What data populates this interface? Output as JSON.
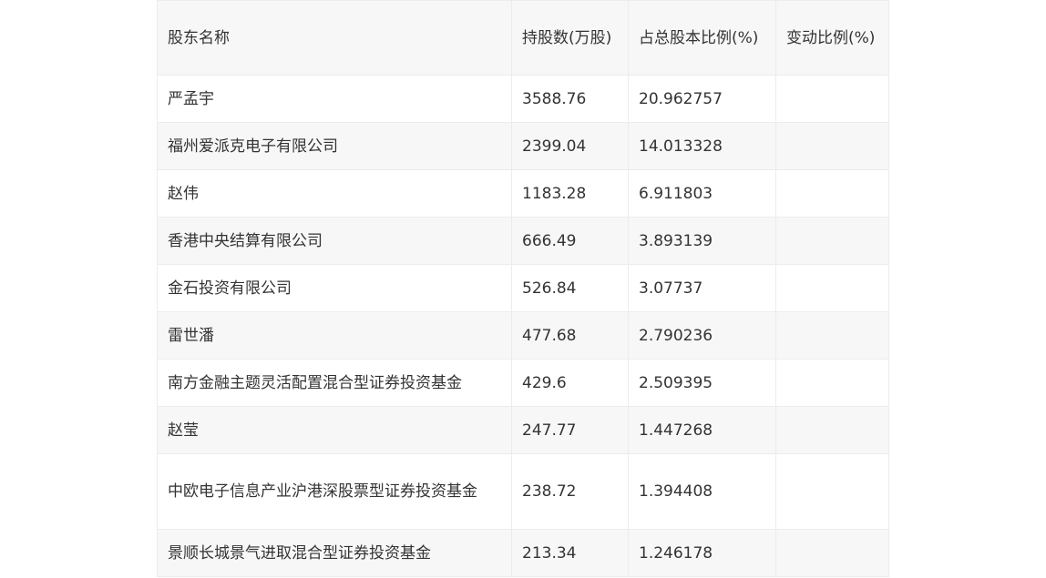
{
  "table": {
    "headers": [
      "股东名称",
      "持股数(万股)",
      "占总股本比例(%)",
      "变动比例(%)"
    ],
    "rows": [
      {
        "name": "严孟宇",
        "shares": "3588.76",
        "ratio": "20.962757",
        "change": ""
      },
      {
        "name": "福州爱派克电子有限公司",
        "shares": "2399.04",
        "ratio": "14.013328",
        "change": ""
      },
      {
        "name": "赵伟",
        "shares": "1183.28",
        "ratio": "6.911803",
        "change": ""
      },
      {
        "name": "香港中央结算有限公司",
        "shares": "666.49",
        "ratio": "3.893139",
        "change": ""
      },
      {
        "name": "金石投资有限公司",
        "shares": "526.84",
        "ratio": "3.07737",
        "change": ""
      },
      {
        "name": "雷世潘",
        "shares": "477.68",
        "ratio": "2.790236",
        "change": ""
      },
      {
        "name": "南方金融主题灵活配置混合型证券投资基金",
        "shares": "429.6",
        "ratio": "2.509395",
        "change": ""
      },
      {
        "name": "赵莹",
        "shares": "247.77",
        "ratio": "1.447268",
        "change": ""
      },
      {
        "name": "中欧电子信息产业沪港深股票型证券投资基金",
        "shares": "238.72",
        "ratio": "1.394408",
        "change": ""
      },
      {
        "name": "景顺长城景气进取混合型证券投资基金",
        "shares": "213.34",
        "ratio": "1.246178",
        "change": ""
      }
    ]
  }
}
